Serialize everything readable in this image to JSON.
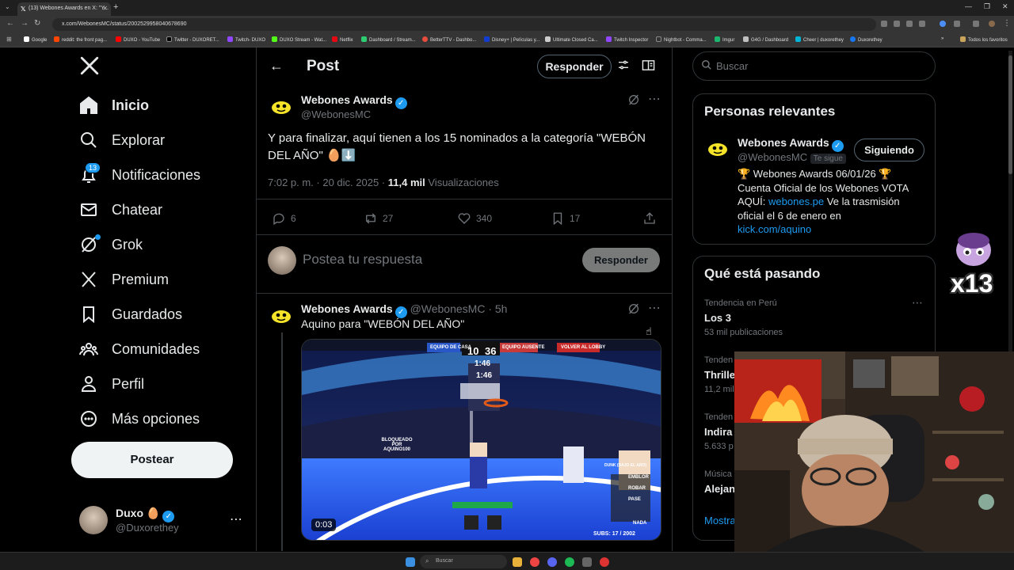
{
  "browser": {
    "tab_title": "(13) Webones Awards en X: \"Y...",
    "url": "x.com/WebonesMC/status/2002529958040678690",
    "bookmarks": [
      "Google",
      "reddit: the front pag...",
      "DUXO - YouTube",
      "Twitter - DUXORET...",
      "Twitch- DUXO",
      "DUXO Stream - Wat...",
      "Netflix",
      "Dashboard / Stream...",
      "BetterTTV - Dashbo...",
      "Disney+ | Películas y...",
      "Ultimate Closed Ca...",
      "Twitch Inspector",
      "Nightbot - Comma...",
      "Imgur",
      "G4G / Dashboard",
      "Cheer | duxorethey",
      "Duxorethey"
    ],
    "all_bookmarks": "Todos los favoritos"
  },
  "nav": {
    "items": [
      {
        "label": "Inicio",
        "icon": "home-icon"
      },
      {
        "label": "Explorar",
        "icon": "search-icon"
      },
      {
        "label": "Notificaciones",
        "icon": "bell-icon"
      },
      {
        "label": "Chatear",
        "icon": "mail-icon"
      },
      {
        "label": "Grok",
        "icon": "grok-icon"
      },
      {
        "label": "Premium",
        "icon": "x-logo-icon"
      },
      {
        "label": "Guardados",
        "icon": "bookmark-icon"
      },
      {
        "label": "Comunidades",
        "icon": "people-icon"
      },
      {
        "label": "Perfil",
        "icon": "person-icon"
      },
      {
        "label": "Más opciones",
        "icon": "more-circle-icon"
      }
    ],
    "notif_count": "13",
    "post_button": "Postear",
    "user_name": "Duxo 🥚",
    "user_handle": "@Duxorethey"
  },
  "post_view": {
    "header_title": "Post",
    "reply_button": "Responder",
    "author_name": "Webones Awards",
    "author_handle": "@WebonesMC",
    "text": "Y para finalizar, aquí tienen a los 15 nominados a la categoría \"WEBÓN DEL AÑO\" 🥚⬇️",
    "time": "7:02 p. m. · 20 dic. 2025 ·",
    "views": "11,4 mil",
    "views_label": "Visualizaciones",
    "stats": {
      "replies": "6",
      "reposts": "27",
      "likes": "340",
      "bookmarks": "17"
    },
    "compose_placeholder": "Postea tu respuesta",
    "compose_button": "Responder"
  },
  "reply_post": {
    "author_name": "Webones Awards",
    "author_handle": "@WebonesMC",
    "age": "· 5h",
    "text": "Aquino para \"WEBÓN DEL AÑO\"",
    "video_duration": "0:03",
    "video_hud": {
      "team_home": "EQUIPO DE CASA",
      "score_home": "10",
      "score_away": "36",
      "team_away": "EQUIPO AUSENTE",
      "back_lobby": "VOLVER AL LOBBY",
      "clock": "1:46",
      "shot_clock": "1:46",
      "blocked": "BLOQUEADO POR AQUINO100",
      "dunk": "DUNK (BAJO EL ARO)",
      "actions": [
        "EMBLOR",
        "ROBAR",
        "PASE"
      ],
      "nada": "NADA",
      "subs": "SUBS: 17 / 2002"
    }
  },
  "search": {
    "placeholder": "Buscar"
  },
  "relevant": {
    "title": "Personas relevantes",
    "name": "Webones Awards",
    "handle": "@WebonesMC",
    "follows_you": "Te sigue",
    "follow_button": "Siguiendo",
    "bio_line1": "🏆 Webones Awards 06/01/26 🏆",
    "bio_line2": "Cuenta Oficial de los Webones VOTA",
    "bio_line3_pre": "AQUÍ:",
    "bio_link1": "webones.pe",
    "bio_line3_post": "Ve la trasmisión",
    "bio_line4": "oficial el 6 de enero en",
    "bio_link2": "kick.com/aquino"
  },
  "trends": {
    "title": "Qué está pasando",
    "items": [
      {
        "context": "Tendencia en Perú",
        "name": "Los 3",
        "count": "53 mil publicaciones"
      },
      {
        "context": "Tenden",
        "name": "Thrille",
        "count": "11,2 mil"
      },
      {
        "context": "Tenden",
        "name": "Indira",
        "count": "5.633 p"
      },
      {
        "context": "Música",
        "name": "Alejan",
        "count": ""
      }
    ],
    "show_more": "Mostra"
  },
  "overlay": {
    "multiplier": "x13"
  },
  "taskbar": {
    "search_placeholder": "Buscar"
  },
  "colors": {
    "accent": "#1d9bf0",
    "background": "#000000",
    "border": "#2f3336",
    "muted": "#71767b"
  }
}
